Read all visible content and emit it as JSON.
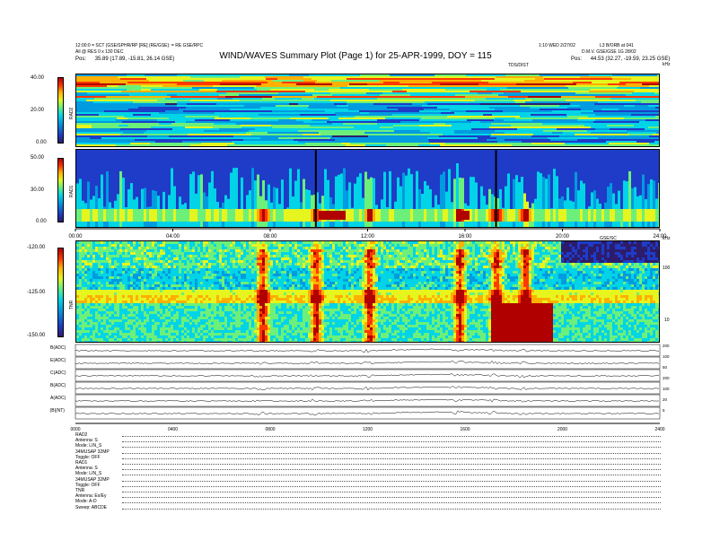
{
  "header": {
    "left_line1": "12:00:0 = SCT (GSE/SPHR/RP [RE] (RE/GSE): = RE GSE/RPC",
    "left_line2": "All @ RES 0 x 130 DEC",
    "left_line3_label": "Pos:",
    "left_line3_value": "35.89 (17.89, -15.81, 26.14 GSE)",
    "title": "WIND/WAVES Summary Plot (Page 1) for 25-APR-1999, DOY = 115",
    "center_right": "1:10 WED 2/27/02",
    "center_label": "TDS/DIST",
    "right_line1": "L3 B/ORB at 041",
    "right_line2": "D.M.V. GSE/GSE 1G 28/02",
    "right_line3_label": "Pos:",
    "right_line3_value": "44.53 (32.27, -19.59, 23.25 GSE)"
  },
  "panels": {
    "rad2": {
      "name": "RAD2",
      "ticks": [
        "40.00",
        "20.00",
        "0.00"
      ]
    },
    "rad1": {
      "name": "RAD1",
      "ticks": [
        "50.00",
        "30.00",
        "0.00"
      ]
    },
    "tnr": {
      "name": "TNR",
      "ticks": [
        "-120.00",
        "-125.00",
        "-150.00"
      ],
      "right_ticks": [
        "100",
        "10"
      ],
      "right_label": "kHz",
      "corner_label": "GSE/SC"
    },
    "time_axis": [
      "00:00",
      "04:00",
      "08:00",
      "12:00",
      "16:00",
      "20:00",
      "24:00"
    ],
    "right_corner": "kHz"
  },
  "chart_data": {
    "type": "heatmap",
    "title": "WIND/WAVES Summary Plot (Page 1) for 25-APR-1999, DOY = 115",
    "x_ticks": [
      "00:00",
      "04:00",
      "08:00",
      "12:00",
      "16:00",
      "20:00",
      "24:00"
    ],
    "xlim": [
      0,
      24
    ],
    "series": [
      {
        "name": "RAD2",
        "ylim": [
          0,
          40
        ],
        "y_ticks": [
          40,
          20,
          0
        ]
      },
      {
        "name": "RAD1",
        "ylim": [
          0,
          50
        ],
        "y_ticks": [
          50,
          30,
          0
        ]
      },
      {
        "name": "TNR",
        "ylim": [
          -150,
          -120
        ],
        "y_ticks": [
          -120,
          -125,
          -150
        ],
        "scale": "log"
      }
    ],
    "colormap": [
      "#2d1c6b",
      "#1e3cc8",
      "#009be0",
      "#00d4e6",
      "#6cf07a",
      "#e6f51e",
      "#ffb000",
      "#ff3a00",
      "#b00000"
    ],
    "bursts_hours": [
      7.6,
      9.8,
      12.0,
      15.7,
      17.2,
      18.4
    ]
  },
  "lines": {
    "labels": [
      "B(ADC)",
      "E(ADC)",
      "C(ADC)",
      "B(ADC)",
      "A(ADC)",
      "|B|(NT)"
    ],
    "right_ticks": [
      "200",
      "100",
      "50",
      "200",
      "100",
      "20",
      "5"
    ],
    "time_axis": [
      "0000",
      "0400",
      "0800",
      "1200",
      "1600",
      "2000",
      "2400"
    ]
  },
  "footer": [
    {
      "k": "RAD2",
      "v": ""
    },
    {
      "k": "Antenna:",
      "v": "S"
    },
    {
      "k": "Mode:",
      "v": "LIN_S"
    },
    {
      "k": "34MUSAP",
      "v": "32MP"
    },
    {
      "k": "Toggle:",
      "v": "OFF"
    },
    {
      "k": "RAD1",
      "v": ""
    },
    {
      "k": "Antenna:",
      "v": "S"
    },
    {
      "k": "Mode:",
      "v": "LIN_S"
    },
    {
      "k": "34MUSAP",
      "v": "32MP"
    },
    {
      "k": "Toggle:",
      "v": "OFF"
    },
    {
      "k": "TNR",
      "v": ""
    },
    {
      "k": "Antenna:",
      "v": "Ex/Ey"
    },
    {
      "k": "Mode:",
      "v": "A-D"
    },
    {
      "k": "Sweep:",
      "v": "ABCDE"
    }
  ]
}
